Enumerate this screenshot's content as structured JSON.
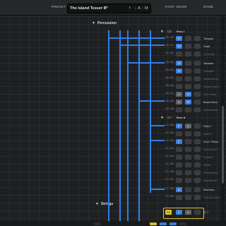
{
  "header": {
    "preset_label": "PRESET",
    "preset_name": "The Island Tesser B*",
    "preset_ctrl_a": "f",
    "preset_ctrl_b": "A",
    "preset_ctrl_c": "M",
    "port_label": "PORT",
    "mode_label": "MODE",
    "name_label": "NAME"
  },
  "sections": {
    "percussion": "Percussion",
    "strings": "Strings"
  },
  "groups": {
    "perc_i_num": "C6",
    "perc_i": "Perc I",
    "perc_ii_num": "C7",
    "perc_ii": "Perc II"
  },
  "rows": [
    {
      "num": "C6:00",
      "name": "Timpani",
      "dim": false
    },
    {
      "num": "C6:01",
      "name": "Piatti",
      "dim": false
    },
    {
      "num": "C6:02",
      "name": "Cymbals",
      "dim": true
    },
    {
      "num": "C6:03",
      "name": "Tamtam",
      "dim": false
    },
    {
      "num": "C6:04",
      "name": "Triangle",
      "dim": true
    },
    {
      "num": "C6:05",
      "name": "Tambourine",
      "dim": true
    },
    {
      "num": "C6:06",
      "name": "Snare Drum",
      "dim": true
    },
    {
      "num": "C6:07",
      "name": "Tom Toms",
      "dim": true
    },
    {
      "num": "C6:08",
      "name": "Bass Drum",
      "dim": false
    },
    {
      "num": "C6:09",
      "name": "Woodblock",
      "dim": true
    },
    {
      "num": "C7:00",
      "name": "Harp I",
      "dim": false
    },
    {
      "num": "C7:01",
      "name": "Harp II",
      "dim": true
    },
    {
      "num": "C7:02",
      "name": "Orch. Piano",
      "dim": false
    },
    {
      "num": "C7:03",
      "name": "Piano Mini",
      "dim": true
    },
    {
      "num": "C7:04",
      "name": "Celesta",
      "dim": true
    },
    {
      "num": "C7:05",
      "name": "Glock.",
      "dim": true
    },
    {
      "num": "C7:06",
      "name": "Vibraphone",
      "dim": true
    },
    {
      "num": "C7:07",
      "name": "Xylophone",
      "dim": true
    },
    {
      "num": "C7:08",
      "name": "Marimba",
      "dim": false
    },
    {
      "num": "C7:09",
      "name": "Tubular Bells",
      "dim": true
    }
  ],
  "cell_labels": {
    "tf": "TF",
    "a": "A",
    "f": "F",
    "fx": "F"
  },
  "strings_row": {
    "num": "C9",
    "name": "Vl. I",
    "cell_a": "FX",
    "cell_b": "T",
    "cell_c": "A"
  }
}
